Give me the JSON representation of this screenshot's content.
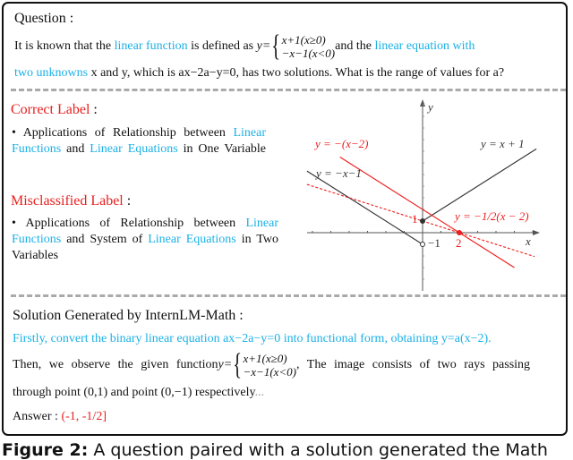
{
  "question": {
    "heading": "Question :",
    "line1_a": "It is known that the ",
    "line1_b": "linear function",
    "line1_c": " is defined as ",
    "y_eq": "y=",
    "case1": "x+1(x≥0)",
    "case2": "−x−1(x<0)",
    "line1_d": " and the ",
    "line1_e": "linear equation with",
    "line2_a": "two unknowns",
    "line2_b": " x and y, which is ax−2a−y=0, has two solutions. What is the range of values for a?"
  },
  "correct": {
    "heading": "Correct Label",
    "colon": " :",
    "bullet": "•",
    "parts": [
      "Applications of Relationship between ",
      "Linear Functions",
      " and ",
      "Linear Equations",
      " in One Variable"
    ]
  },
  "misclassified": {
    "heading": "Misclassified Label",
    "colon": " :",
    "bullet": "•",
    "parts": [
      "Applications of Relationship between ",
      "Linear Functions",
      " and System of ",
      "Linear Equations",
      " in Two Variables"
    ]
  },
  "graph": {
    "x_label": "x",
    "y_label": "y",
    "lines": [
      {
        "label": "y = x + 1",
        "slope": 1,
        "intercept": 1,
        "domain": [
          0,
          6.2
        ],
        "color": "#333333",
        "style": "solid"
      },
      {
        "label": "y = −x−1",
        "slope": -1,
        "intercept": -1,
        "domain": [
          -6.3,
          0
        ],
        "color": "#333333",
        "style": "solid"
      },
      {
        "label": "y = −(x−2)",
        "slope": -1,
        "intercept": 2,
        "domain": [
          -4.5,
          5
        ],
        "color": "#ee1c1c",
        "style": "solid"
      },
      {
        "label": "y = −1/2(x − 2)",
        "slope": -0.5,
        "intercept": 1,
        "domain": [
          -6.3,
          6.1
        ],
        "color": "#ee1c1c",
        "style": "dashed"
      }
    ],
    "tick_labels": {
      "one": "1",
      "minus_one": "−1",
      "two": "2"
    },
    "points": [
      {
        "x": 0,
        "y": 1,
        "filled": true
      },
      {
        "x": 0,
        "y": -1,
        "filled": false
      },
      {
        "x": 2,
        "y": 0,
        "filled": true
      }
    ]
  },
  "solution": {
    "heading": "Solution Generated by InternLM-Math :",
    "line1": "Firstly, convert the binary linear equation ax−2a−y=0 into functional form, obtaining y=a(x−2).",
    "line2_a": "Then, we observe the given function",
    "y_eq": "y=",
    "case1": "x+1(x≥0)",
    "case2": "−x−1(x<0)",
    "line2_b": ", The image consists of two rays passing",
    "line3": "through point (0,1) and point (0,−1) respectively",
    "ellipsis": "...",
    "answer_label": "Answer : ",
    "answer_value": "(-1, -1/2]"
  },
  "caption": {
    "bold": "Figure 2:",
    "text": " A question paired with a solution generated the Math"
  }
}
